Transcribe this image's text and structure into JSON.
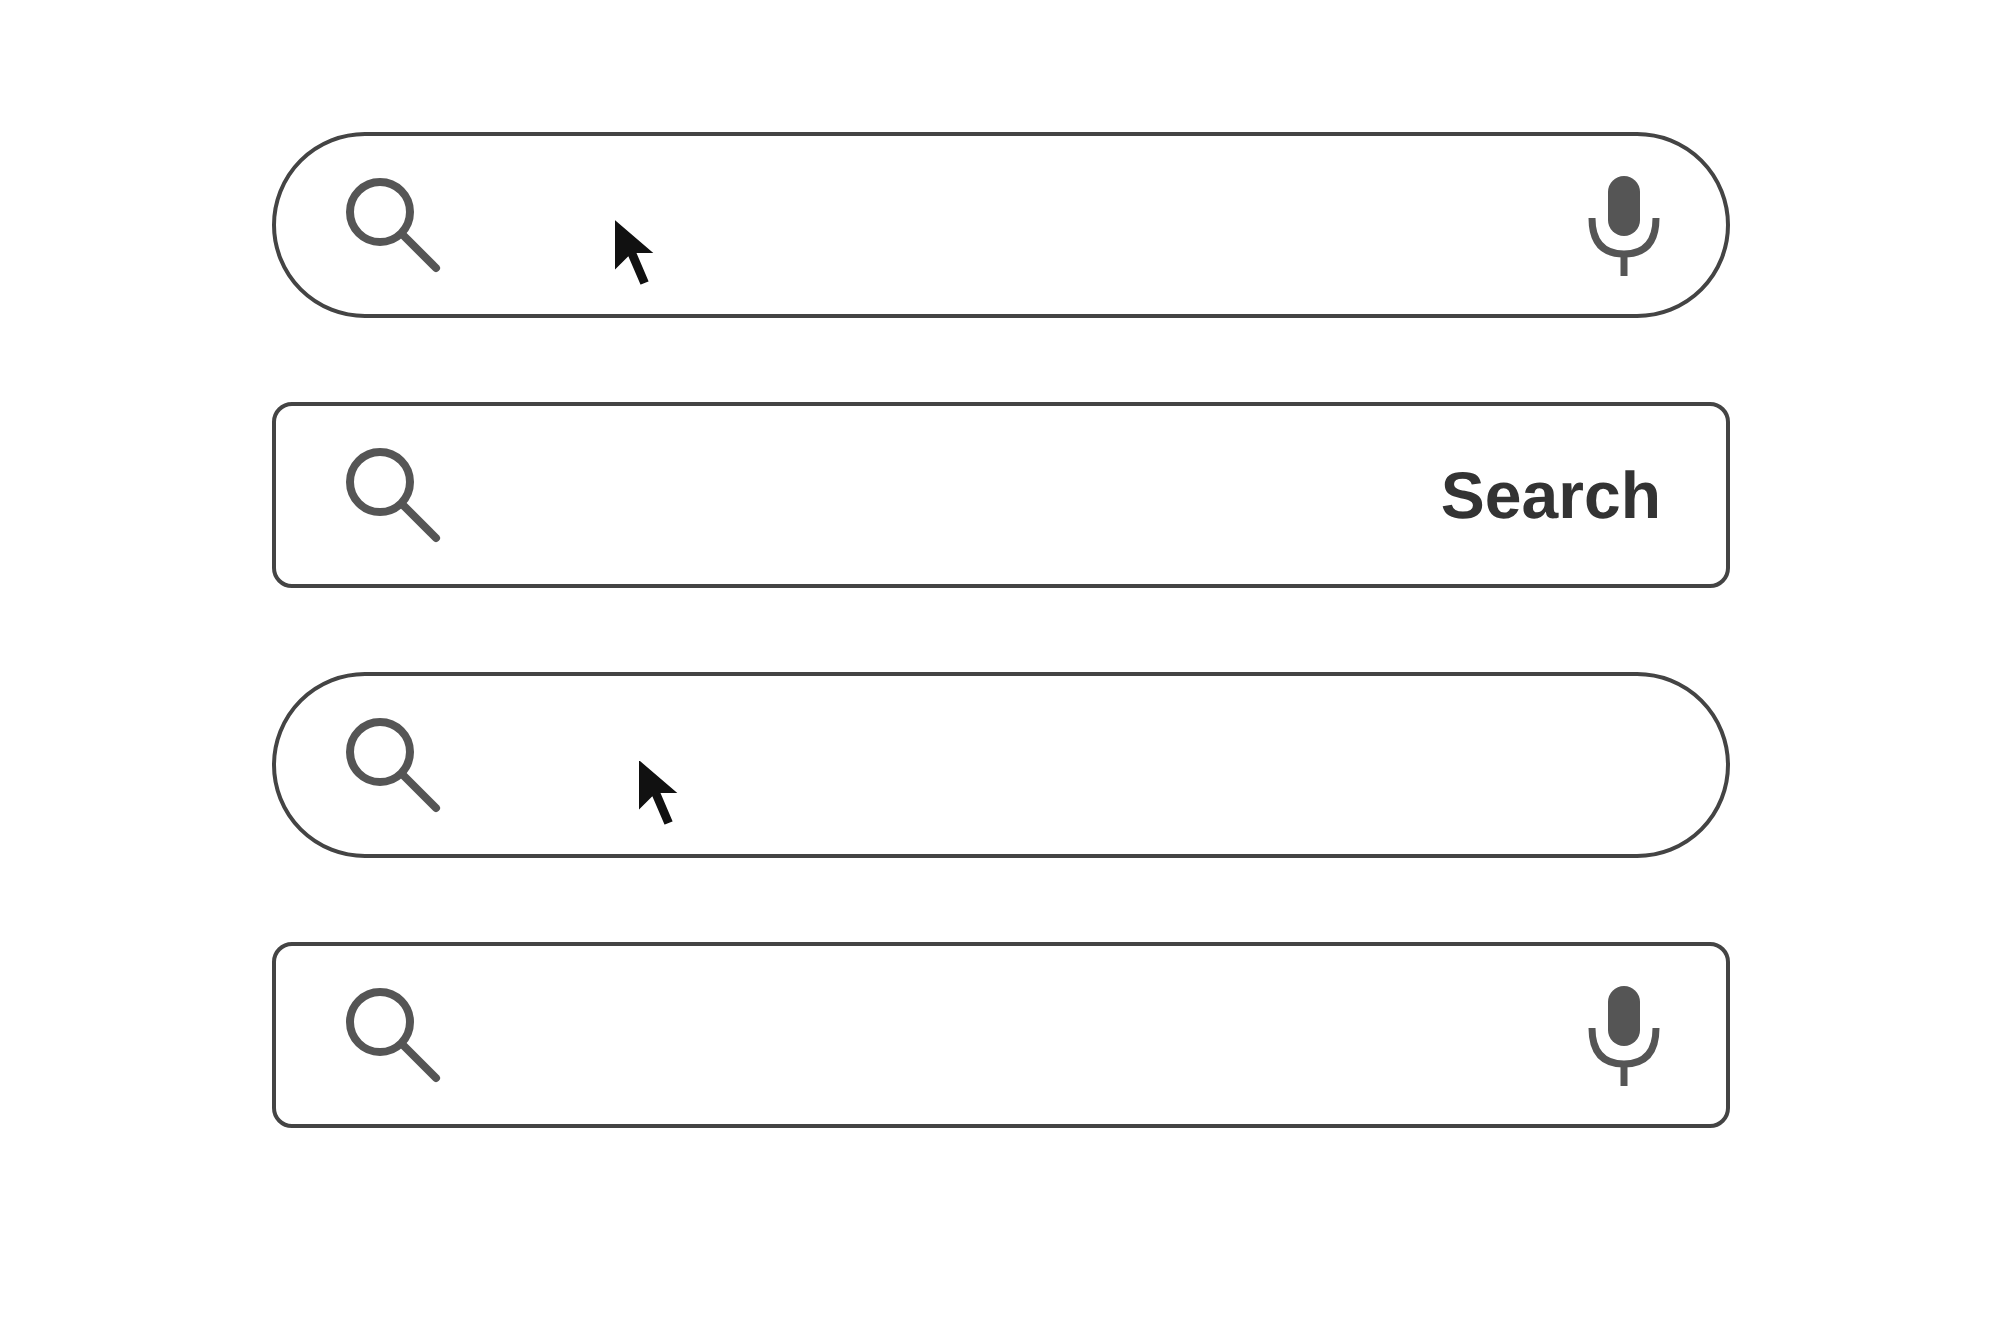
{
  "search_bars": [
    {
      "kind": "pill",
      "mic": true,
      "cursor": true
    },
    {
      "kind": "rounded",
      "mic": false,
      "cursor": false,
      "button_label": "Search"
    },
    {
      "kind": "pill",
      "mic": false,
      "cursor": true
    },
    {
      "kind": "rounded",
      "mic": true,
      "cursor": false
    }
  ]
}
